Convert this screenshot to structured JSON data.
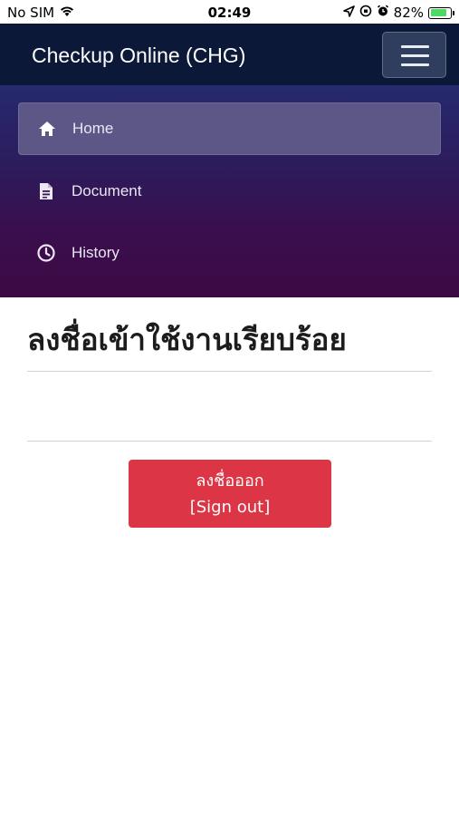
{
  "status_bar": {
    "carrier": "No SIM",
    "time": "02:49",
    "battery": "82%",
    "battery_level": 0.82,
    "icons": [
      "wifi-icon",
      "location-icon",
      "orientation-lock-icon",
      "alarm-icon",
      "battery-charging-icon"
    ]
  },
  "navbar": {
    "brand": "Checkup Online (CHG)",
    "toggler_icon": "hamburger-menu-icon"
  },
  "menu": {
    "items": [
      {
        "label": "Home",
        "icon": "home-icon",
        "active": true
      },
      {
        "label": "Document",
        "icon": "document-icon",
        "active": false
      },
      {
        "label": "History",
        "icon": "clock-icon",
        "active": false
      }
    ]
  },
  "main": {
    "title": "ลงชื่อเข้าใช้งานเรียบร้อย",
    "signout_line1": "ลงชื่อออก",
    "signout_line2": "[Sign out]"
  },
  "colors": {
    "navbar": "#0c1838",
    "menu_top": "#262a6e",
    "menu_bottom": "#3d0a45",
    "danger": "#dc3545"
  }
}
